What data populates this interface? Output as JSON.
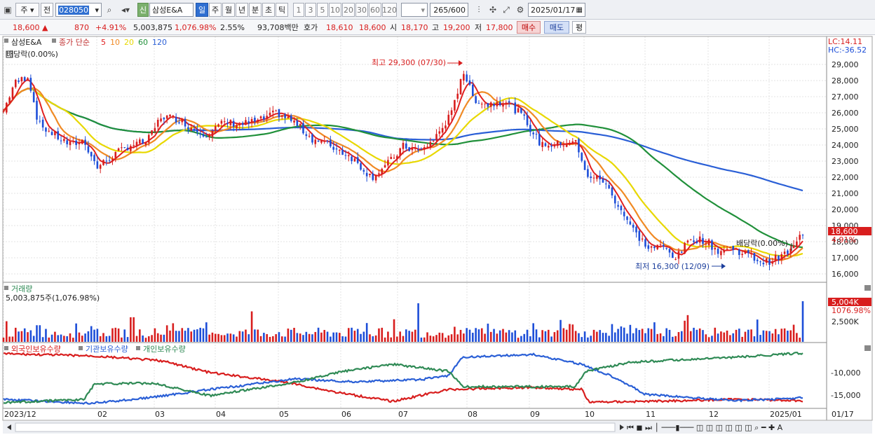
{
  "toolbar": {
    "period_label": "주",
    "prev_label": "전",
    "code": "028050",
    "name": "삼성E&A",
    "new_badge": "신",
    "tabs": [
      {
        "label": "일",
        "active": true
      },
      {
        "label": "주"
      },
      {
        "label": "월"
      },
      {
        "label": "년"
      },
      {
        "label": "분"
      },
      {
        "label": "초"
      },
      {
        "label": "틱"
      }
    ],
    "intervals": [
      "1",
      "3",
      "5",
      "10",
      "20",
      "30",
      "60",
      "120"
    ],
    "count": "265",
    "count_max": "/600",
    "date": "2025/01/17"
  },
  "quote": {
    "price": "18,600",
    "arrow": "▲",
    "change": "870",
    "change_pct": "+4.91%",
    "volume": "5,003,875",
    "volume_pct": "1,076.98%",
    "turnover_rate": "2.55%",
    "amount": "93,708백만",
    "ask_label": "호가",
    "ask": "18,610",
    "bid": "18,600",
    "open_label": "시",
    "open": "18,170",
    "high_label": "고",
    "high": "19,200",
    "low_label": "저",
    "low": "17,800",
    "buy_label": "매수",
    "sell_label": "매도",
    "eval_label": "평"
  },
  "price_panel": {
    "series_name": "삼성E&A",
    "ma_label": "종가 단순",
    "ma_periods": [
      {
        "p": "5",
        "color": "#e02020"
      },
      {
        "p": "10",
        "color": "#f08a24"
      },
      {
        "p": "20",
        "color": "#e8d800"
      },
      {
        "p": "60",
        "color": "#20903a"
      },
      {
        "p": "120",
        "color": "#2a5fd6"
      }
    ],
    "ex_dividend_top": "배당락(0.00%)",
    "lc": "LC:14.11",
    "hc": "HC:-36.52",
    "max_label": "최고 29,300 (07/30)",
    "min_label": "최저 16,300 (12/09)",
    "ex_dividend_label": "배당락(0.00%)",
    "last_price": "18,600",
    "last_pct": "4.91%",
    "y_ticks": [
      "29,000",
      "28,000",
      "27,000",
      "26,000",
      "25,000",
      "24,000",
      "23,000",
      "22,000",
      "21,000",
      "20,000",
      "19,000",
      "18,000",
      "17,000",
      "16,000"
    ]
  },
  "volume_panel": {
    "title": "거래량",
    "value": "5,003,875주(1,076.98%)",
    "last": "5,004K",
    "last_pct": "1076.98%",
    "y_tick": "2,500K"
  },
  "holdings_panel": {
    "series": [
      {
        "name": "외국인보유수량",
        "color": "#d81e1e"
      },
      {
        "name": "기관보유수량",
        "color": "#2a5fd6"
      },
      {
        "name": "개인보유수량",
        "color": "#2f8a55"
      }
    ],
    "y_ticks": [
      "-10,000",
      "-15,000"
    ]
  },
  "x_axis": {
    "labels": [
      "2023/12",
      "02",
      "03",
      "04",
      "05",
      "06",
      "07",
      "08",
      "09",
      "10",
      "11",
      "12",
      "2025/01"
    ],
    "right_date": "01/17"
  },
  "colors": {
    "up": "#d81e1e",
    "down": "#1d4ed8",
    "panel_border": "#808080"
  }
}
